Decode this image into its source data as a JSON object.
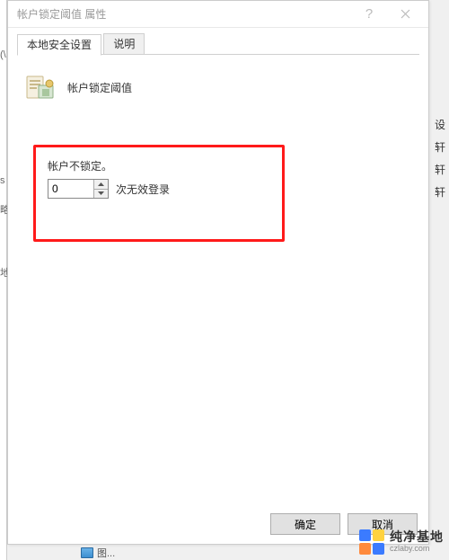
{
  "background": {
    "right_fragments": [
      "设",
      "轩",
      "轩",
      "轩"
    ],
    "left_fragments": [
      "(\\",
      "s ",
      "略",
      "地"
    ],
    "bottom_text": "图..."
  },
  "dialog": {
    "title": "帐户锁定阈值 属性",
    "help_tooltip": "?",
    "close_tooltip": "×"
  },
  "tabs": {
    "security": "本地安全设置",
    "explain": "说明"
  },
  "policy": {
    "heading": "帐户锁定阈值"
  },
  "field": {
    "label": "帐户不锁定。",
    "value": "0",
    "unit": "次无效登录"
  },
  "buttons": {
    "ok": "确定",
    "cancel": "取消"
  },
  "watermark": {
    "cn": "纯净基地",
    "en": "czlaby.com"
  }
}
